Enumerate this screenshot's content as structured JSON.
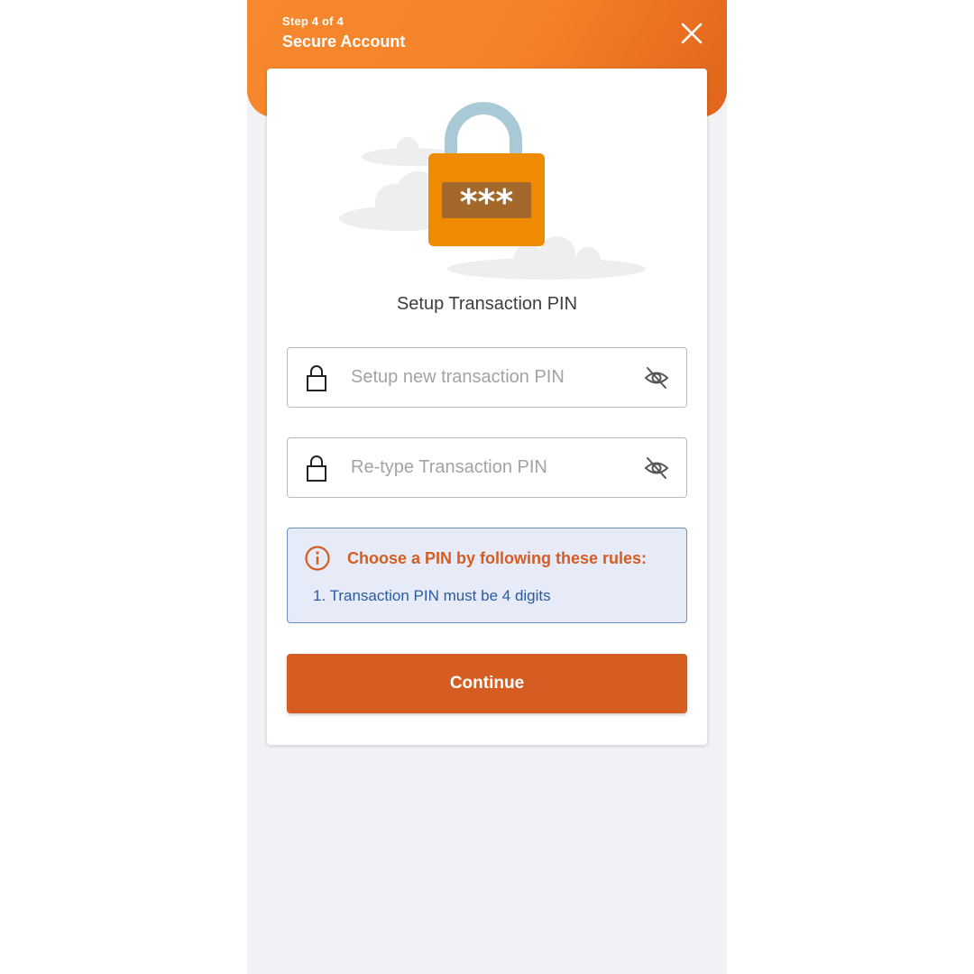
{
  "header": {
    "step": "Step 4 of 4",
    "title": "Secure Account",
    "close_icon": "close-icon"
  },
  "colors": {
    "header_orange": "#f48229",
    "accent": "#d65d22",
    "rules_bg": "#e6ebf7",
    "rules_border": "#6c8fcb",
    "rules_text": "#2c5aa0",
    "lock_body": "#ef8b00",
    "lock_shackle": "#a9c9d6"
  },
  "illustration": {
    "icon": "padlock-icon",
    "masked_text": "***"
  },
  "title": "Setup Transaction PIN",
  "fields": [
    {
      "placeholder": "Setup new transaction PIN",
      "value": "",
      "left_icon": "lock-icon",
      "right_icon": "eye-off-icon"
    },
    {
      "placeholder": "Re-type Transaction PIN",
      "value": "",
      "left_icon": "lock-icon",
      "right_icon": "eye-off-icon"
    }
  ],
  "rules": {
    "icon": "info-icon",
    "title": "Choose a PIN by following these rules:",
    "items": [
      "1. Transaction PIN must be 4 digits"
    ]
  },
  "continue_label": "Continue"
}
